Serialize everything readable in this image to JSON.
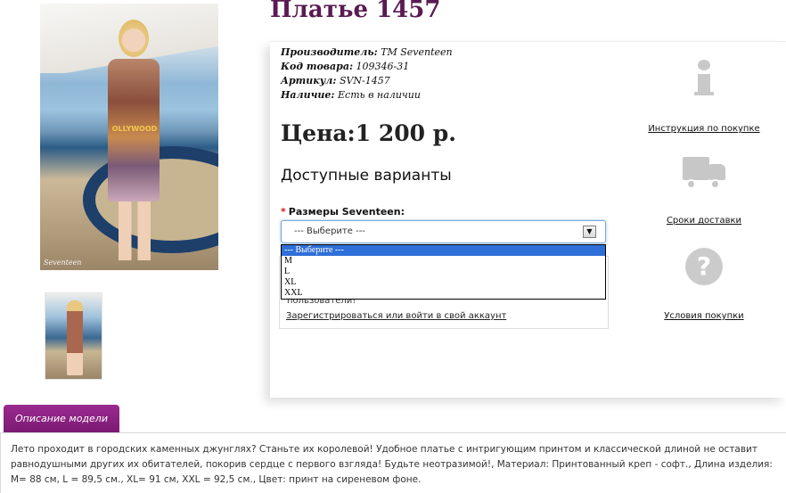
{
  "product": {
    "title": "Платье 1457",
    "specs": [
      {
        "label": "Производитель:",
        "value": "TM Seventeen"
      },
      {
        "label": "Код товара:",
        "value": "109346-31"
      },
      {
        "label": "Артикул:",
        "value": "SVN-1457"
      },
      {
        "label": "Наличие:",
        "value": "Есть в наличии"
      }
    ],
    "price": "Цена:1 200 р.",
    "photo_print_text": "OLLYWOOD",
    "photo_signature": "Seventeen"
  },
  "options": {
    "title": "Доступные варианты",
    "size_label": "Размеры Seventeen:",
    "required_mark": "*",
    "select_value": "--- Выберите ---",
    "select_arrow": "▼",
    "dropdown_options": [
      "--- Выберите ---",
      "M",
      "L",
      "XL",
      "XXL"
    ]
  },
  "login": {
    "note": "пользователи!",
    "link": "Зарегистрироваться или войти в свой аккаунт"
  },
  "side": {
    "instructions": "Инструкция по покупке",
    "delivery": "Сроки доставки",
    "terms": "Условия покупки",
    "question_mark": "?"
  },
  "description": {
    "tab_label": "Описание модели",
    "text": "Лето проходит в городских каменных джунглях? Станьте их королевой! Удобное платье с интригующим принтом и классической длиной не оставит равнодушными других их обитателей, покорив сердце с первого взгляда! Будьте неотразимой!, Материал: Принтованный креп - софт., Длина изделия: M= 88 см, L = 89,5 см., XL= 91 см, XXL = 92,5 см., Цвет: принт на сиреневом фоне."
  },
  "colors": {
    "title": "#5a1a52",
    "tab": "#8a2182",
    "required": "#d8141f",
    "selected_option": "#2f6fd8"
  }
}
